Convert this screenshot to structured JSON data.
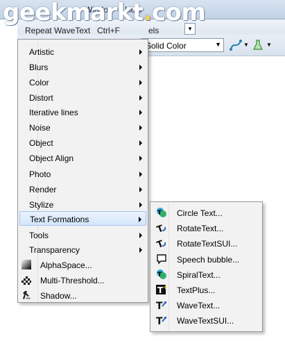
{
  "watermark": {
    "text": "geekmarkt.com"
  },
  "menubar": {
    "items": [
      "Window",
      "Help"
    ]
  },
  "repeat": {
    "label": "Repeat WaveText",
    "shortcut": "Ctrl+F",
    "hidden_text": "els"
  },
  "toolbar": {
    "fill_select": "Solid Color"
  },
  "menu": {
    "items": [
      {
        "label": "Artistic",
        "submenu": true
      },
      {
        "label": "Blurs",
        "submenu": true
      },
      {
        "label": "Color",
        "submenu": true
      },
      {
        "label": "Distort",
        "submenu": true
      },
      {
        "label": "Iterative lines",
        "submenu": true
      },
      {
        "label": "Noise",
        "submenu": true
      },
      {
        "label": "Object",
        "submenu": true
      },
      {
        "label": "Object Align",
        "submenu": true
      },
      {
        "label": "Photo",
        "submenu": true
      },
      {
        "label": "Render",
        "submenu": true
      },
      {
        "label": "Stylize",
        "submenu": true
      },
      {
        "label": "Text Formations",
        "submenu": true,
        "highlighted": true
      },
      {
        "label": "Tools",
        "submenu": true
      },
      {
        "label": "Transparency",
        "submenu": true
      },
      {
        "label": "AlphaSpace...",
        "icon": "alphaspace-icon"
      },
      {
        "label": "Multi-Threshold...",
        "icon": "multi-threshold-icon"
      },
      {
        "label": "Shadow...",
        "icon": "shadow-icon"
      }
    ]
  },
  "submenu": {
    "items": [
      {
        "label": "Circle Text...",
        "icon": "circle-text-icon"
      },
      {
        "label": "RotateText...",
        "icon": "rotate-text-icon"
      },
      {
        "label": "RotateTextSUI...",
        "icon": "rotate-text-sui-icon"
      },
      {
        "label": "Speech bubble...",
        "icon": "speech-bubble-icon"
      },
      {
        "label": "SpiralText...",
        "icon": "spiral-text-icon"
      },
      {
        "label": "TextPlus...",
        "icon": "text-plus-icon"
      },
      {
        "label": "WaveText...",
        "icon": "wave-text-icon"
      },
      {
        "label": "WaveTextSUI...",
        "icon": "wave-text-sui-icon"
      }
    ]
  }
}
